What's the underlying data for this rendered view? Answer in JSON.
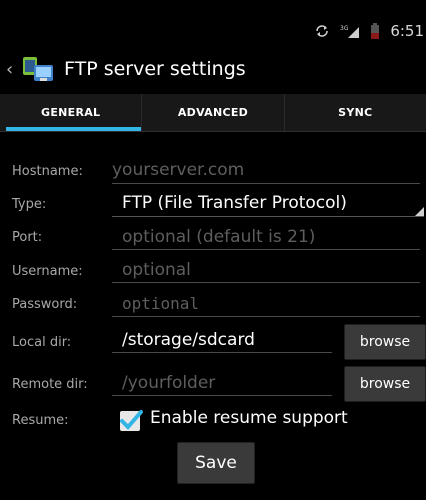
{
  "status_bar": {
    "time": "6:51",
    "network": "3G"
  },
  "action_bar": {
    "title": "FTP server settings"
  },
  "tabs": [
    {
      "label": "GENERAL",
      "active": true
    },
    {
      "label": "ADVANCED",
      "active": false
    },
    {
      "label": "SYNC",
      "active": false
    }
  ],
  "form": {
    "hostname": {
      "label": "Hostname:",
      "placeholder": "yourserver.com",
      "value": ""
    },
    "type": {
      "label": "Type:",
      "value": "FTP (File Transfer Protocol)"
    },
    "port": {
      "label": "Port:",
      "placeholder": "optional (default is 21)",
      "value": ""
    },
    "username": {
      "label": "Username:",
      "placeholder": "optional",
      "value": ""
    },
    "password": {
      "label": "Password:",
      "placeholder": "optional",
      "value": ""
    },
    "local_dir": {
      "label": "Local dir:",
      "value": "/storage/sdcard",
      "button": "browse"
    },
    "remote_dir": {
      "label": "Remote dir:",
      "placeholder": "/yourfolder",
      "value": "",
      "button": "browse"
    },
    "resume": {
      "label": "Resume:",
      "checkbox_label": "Enable resume support",
      "checked": true
    }
  },
  "save_label": "Save",
  "colors": {
    "accent": "#33b5e5",
    "background": "#000000"
  }
}
